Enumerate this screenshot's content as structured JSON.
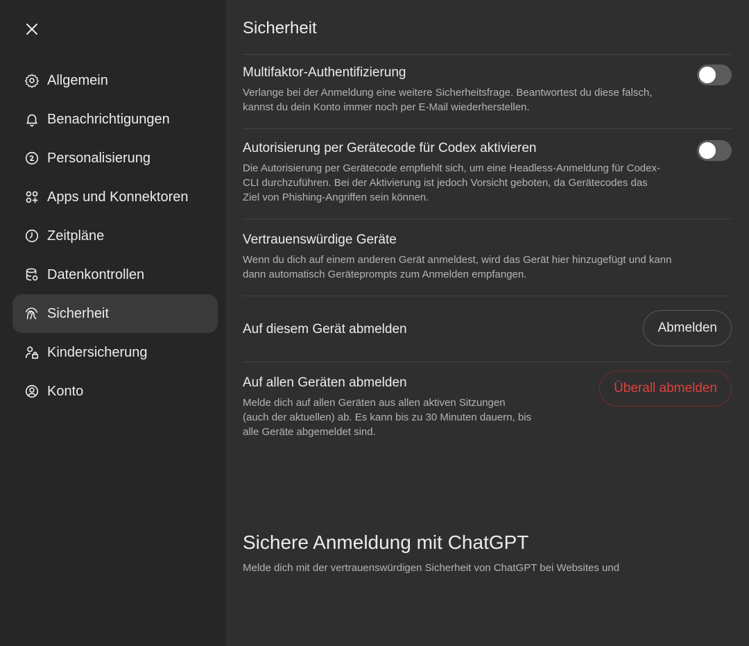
{
  "sidebar": {
    "close_icon": "close-icon",
    "items": [
      {
        "label": "Allgemein",
        "icon": "gear-icon"
      },
      {
        "label": "Benachrichtigungen",
        "icon": "bell-icon"
      },
      {
        "label": "Personalisierung",
        "icon": "personalization-icon"
      },
      {
        "label": "Apps und Konnektoren",
        "icon": "apps-icon"
      },
      {
        "label": "Zeitpläne",
        "icon": "clock-icon"
      },
      {
        "label": "Datenkontrollen",
        "icon": "database-settings-icon"
      },
      {
        "label": "Sicherheit",
        "icon": "security-icon",
        "active": true
      },
      {
        "label": "Kindersicherung",
        "icon": "parental-lock-icon"
      },
      {
        "label": "Konto",
        "icon": "account-icon"
      }
    ]
  },
  "main": {
    "title": "Sicherheit",
    "mfa": {
      "title": "Multifaktor-Authentifizierung",
      "description": "Verlange bei der Anmeldung eine weitere Sicherheitsfrage. Beantwortest du diese falsch, kannst du dein Konto immer noch per E-Mail wiederherstellen.",
      "enabled": false
    },
    "device_code": {
      "title": "Autorisierung per Gerätecode für Codex aktivieren",
      "description": "Die Autorisierung per Gerätecode empfiehlt sich, um eine Headless-Anmeldung für Codex-CLI durchzuführen. Bei der Aktivierung ist jedoch Vorsicht geboten, da Gerätecodes das Ziel von Phishing-Angriffen sein können.",
      "enabled": false
    },
    "trusted_devices": {
      "title": "Vertrauenswürdige Geräte",
      "description": "Wenn du dich auf einem anderen Gerät anmeldest, wird das Gerät hier hinzugefügt und kann dann automatisch Geräteprompts zum Anmelden empfangen."
    },
    "logout_this": {
      "title": "Auf diesem Gerät abmelden",
      "button": "Abmelden"
    },
    "logout_all": {
      "title": "Auf allen Geräten abmelden",
      "description": "Melde dich auf allen Geräten aus allen aktiven Sitzungen (auch der aktuellen) ab. Es kann bis zu 30 Minuten dauern, bis alle Geräte abgemeldet sind.",
      "button": "Überall abmelden"
    },
    "secure_login": {
      "title": "Sichere Anmeldung mit ChatGPT",
      "description": "Melde dich mit der vertrauenswürdigen Sicherheit von ChatGPT bei Websites und"
    }
  },
  "colors": {
    "sidebar_bg": "#262626",
    "main_bg": "#2f2f2f",
    "active_item_bg": "#3a3a3a",
    "danger": "#e0403d",
    "toggle_off": "#5c5c5c"
  }
}
